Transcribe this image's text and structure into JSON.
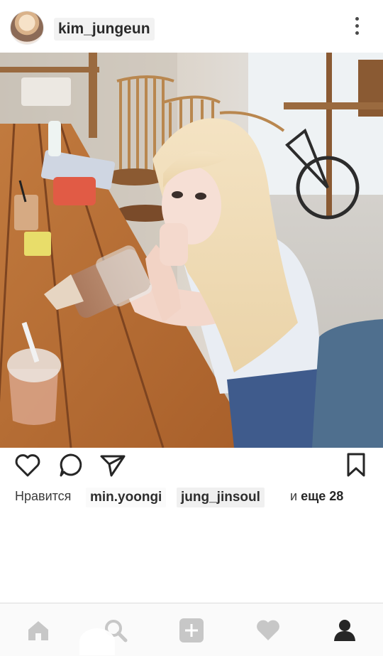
{
  "header": {
    "username": "kim_jungeun",
    "avatar_icon": "profile-photo",
    "more_icon": "more-vertical-icon"
  },
  "post": {
    "image_icon": "photo-girl-drinking-iced-coffee-cafe"
  },
  "actions": {
    "like_icon": "heart-outline-icon",
    "comment_icon": "comment-bubble-icon",
    "share_icon": "send-paper-plane-icon",
    "save_icon": "bookmark-icon"
  },
  "likes": {
    "prefix": "Нравится",
    "user1": "min.yoongi",
    "user2": "jung_jinsoul",
    "and": "и",
    "more": "еще 28"
  },
  "nav": {
    "items": [
      "home-icon",
      "search-icon",
      "add-post-icon",
      "activity-heart-icon",
      "profile-icon"
    ],
    "active": "profile-icon",
    "inactive_color": "#c7c7c7",
    "active_color": "#262626"
  }
}
